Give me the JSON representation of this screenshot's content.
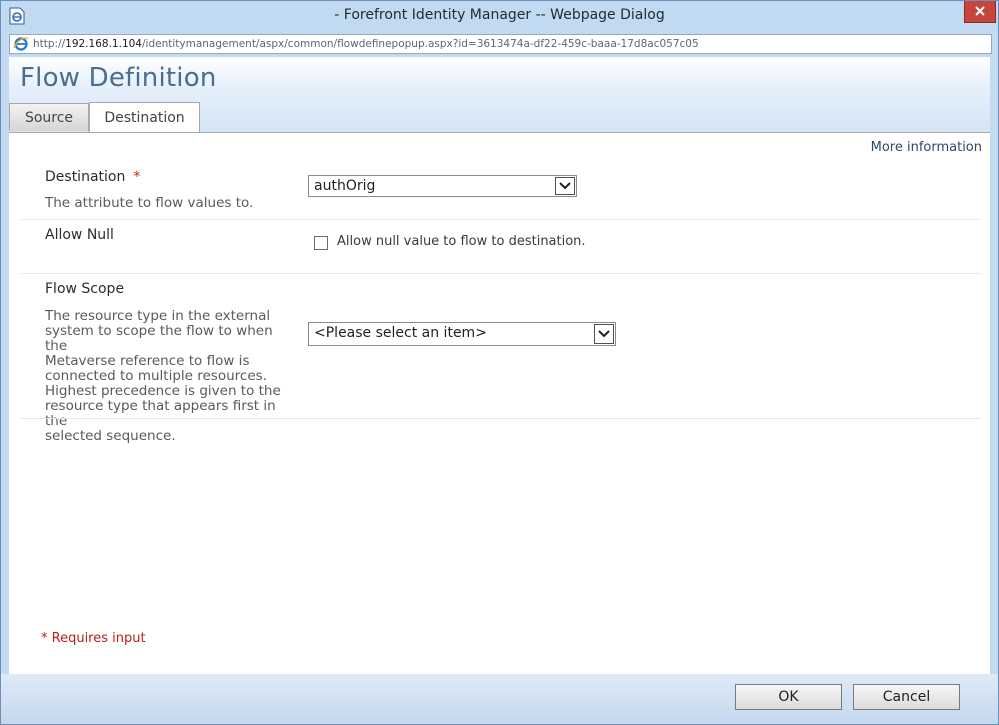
{
  "window": {
    "title": "- Forefront Identity Manager -- Webpage Dialog",
    "address_prefix": "http://",
    "address_host": "192.168.1.104",
    "address_path": "/identitymanagement/aspx/common/flowdefinepopup.aspx?id=3613474a-df22-459c-baaa-17d8ac057c05"
  },
  "header": {
    "title": "Flow Definition",
    "tabs": [
      {
        "label": "Source",
        "selected": false
      },
      {
        "label": "Destination",
        "selected": true
      }
    ]
  },
  "content": {
    "more_info": "More information",
    "destination": {
      "label": "Destination",
      "required_mark": "*",
      "description": "The attribute to flow values to.",
      "selected_value": "authOrig"
    },
    "allow_null": {
      "label": "Allow Null",
      "checkbox_label": "Allow null value to flow to destination.",
      "checked": false
    },
    "flow_scope": {
      "label": "Flow Scope",
      "description_lines": [
        "The resource type in the external",
        "system to scope the flow to when the",
        "Metaverse reference to flow is",
        "connected to multiple resources.",
        "Highest precedence is given to the",
        "resource type that appears first in the",
        "selected sequence."
      ],
      "selected_value": "<Please select an item>"
    },
    "requires_input_note": "* Requires input"
  },
  "footer": {
    "ok_label": "OK",
    "cancel_label": "Cancel"
  },
  "colors": {
    "title_blue": "#4b6d90",
    "required_red": "#cc2020",
    "close_red": "#c7463c"
  }
}
